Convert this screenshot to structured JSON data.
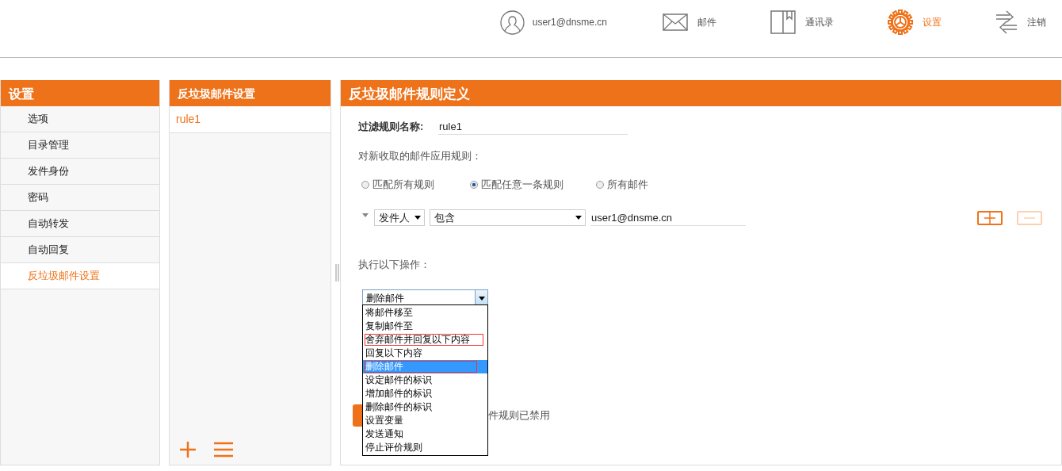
{
  "header": {
    "user": "user1@dnsme.cn",
    "nav": [
      {
        "label": "邮件",
        "selected": false
      },
      {
        "label": "通讯录",
        "selected": false
      },
      {
        "label": "设置",
        "selected": true
      },
      {
        "label": "注销",
        "selected": false
      }
    ]
  },
  "sidebar": {
    "title": "设置",
    "items": [
      {
        "label": "选项",
        "selected": false
      },
      {
        "label": "目录管理",
        "selected": false
      },
      {
        "label": "发件身份",
        "selected": false
      },
      {
        "label": "密码",
        "selected": false
      },
      {
        "label": "自动转发",
        "selected": false
      },
      {
        "label": "自动回复",
        "selected": false
      },
      {
        "label": "反垃圾邮件设置",
        "selected": true
      }
    ]
  },
  "rules_panel": {
    "title": "反垃圾邮件设置",
    "rules": [
      {
        "name": "rule1",
        "selected": true
      }
    ]
  },
  "editor": {
    "title": "反垃圾邮件规则定义",
    "name_label": "过滤规则名称:",
    "name_value": "rule1",
    "apply_label": "对新收取的邮件应用规则：",
    "match_options": [
      {
        "label": "匹配所有规则",
        "selected": false
      },
      {
        "label": "匹配任意一条规则",
        "selected": true
      },
      {
        "label": "所有邮件",
        "selected": false
      }
    ],
    "condition": {
      "field": "发件人",
      "operator": "包含",
      "value": "user1@dnsme.cn",
      "add_enabled": true,
      "remove_enabled": false
    },
    "actions_label": "执行以下操作：",
    "action_select": {
      "value": "删除邮件",
      "expanded": true,
      "options": [
        {
          "label": "将邮件移至",
          "selected": false,
          "outlined": false
        },
        {
          "label": "复制邮件至",
          "selected": false,
          "outlined": false
        },
        {
          "label": "舍弃邮件并回复以下内容",
          "selected": false,
          "outlined": true
        },
        {
          "label": "回复以下内容",
          "selected": false,
          "outlined": false
        },
        {
          "label": "删除邮件",
          "selected": true,
          "outlined": true
        },
        {
          "label": "设定邮件的标识",
          "selected": false,
          "outlined": false
        },
        {
          "label": "增加邮件的标识",
          "selected": false,
          "outlined": false
        },
        {
          "label": "删除邮件的标识",
          "selected": false,
          "outlined": false
        },
        {
          "label": "设置变量",
          "selected": false,
          "outlined": false
        },
        {
          "label": "发送通知",
          "selected": false,
          "outlined": false
        },
        {
          "label": "停止评价规则",
          "selected": false,
          "outlined": false
        }
      ]
    },
    "status_text": "件规则已禁用"
  }
}
